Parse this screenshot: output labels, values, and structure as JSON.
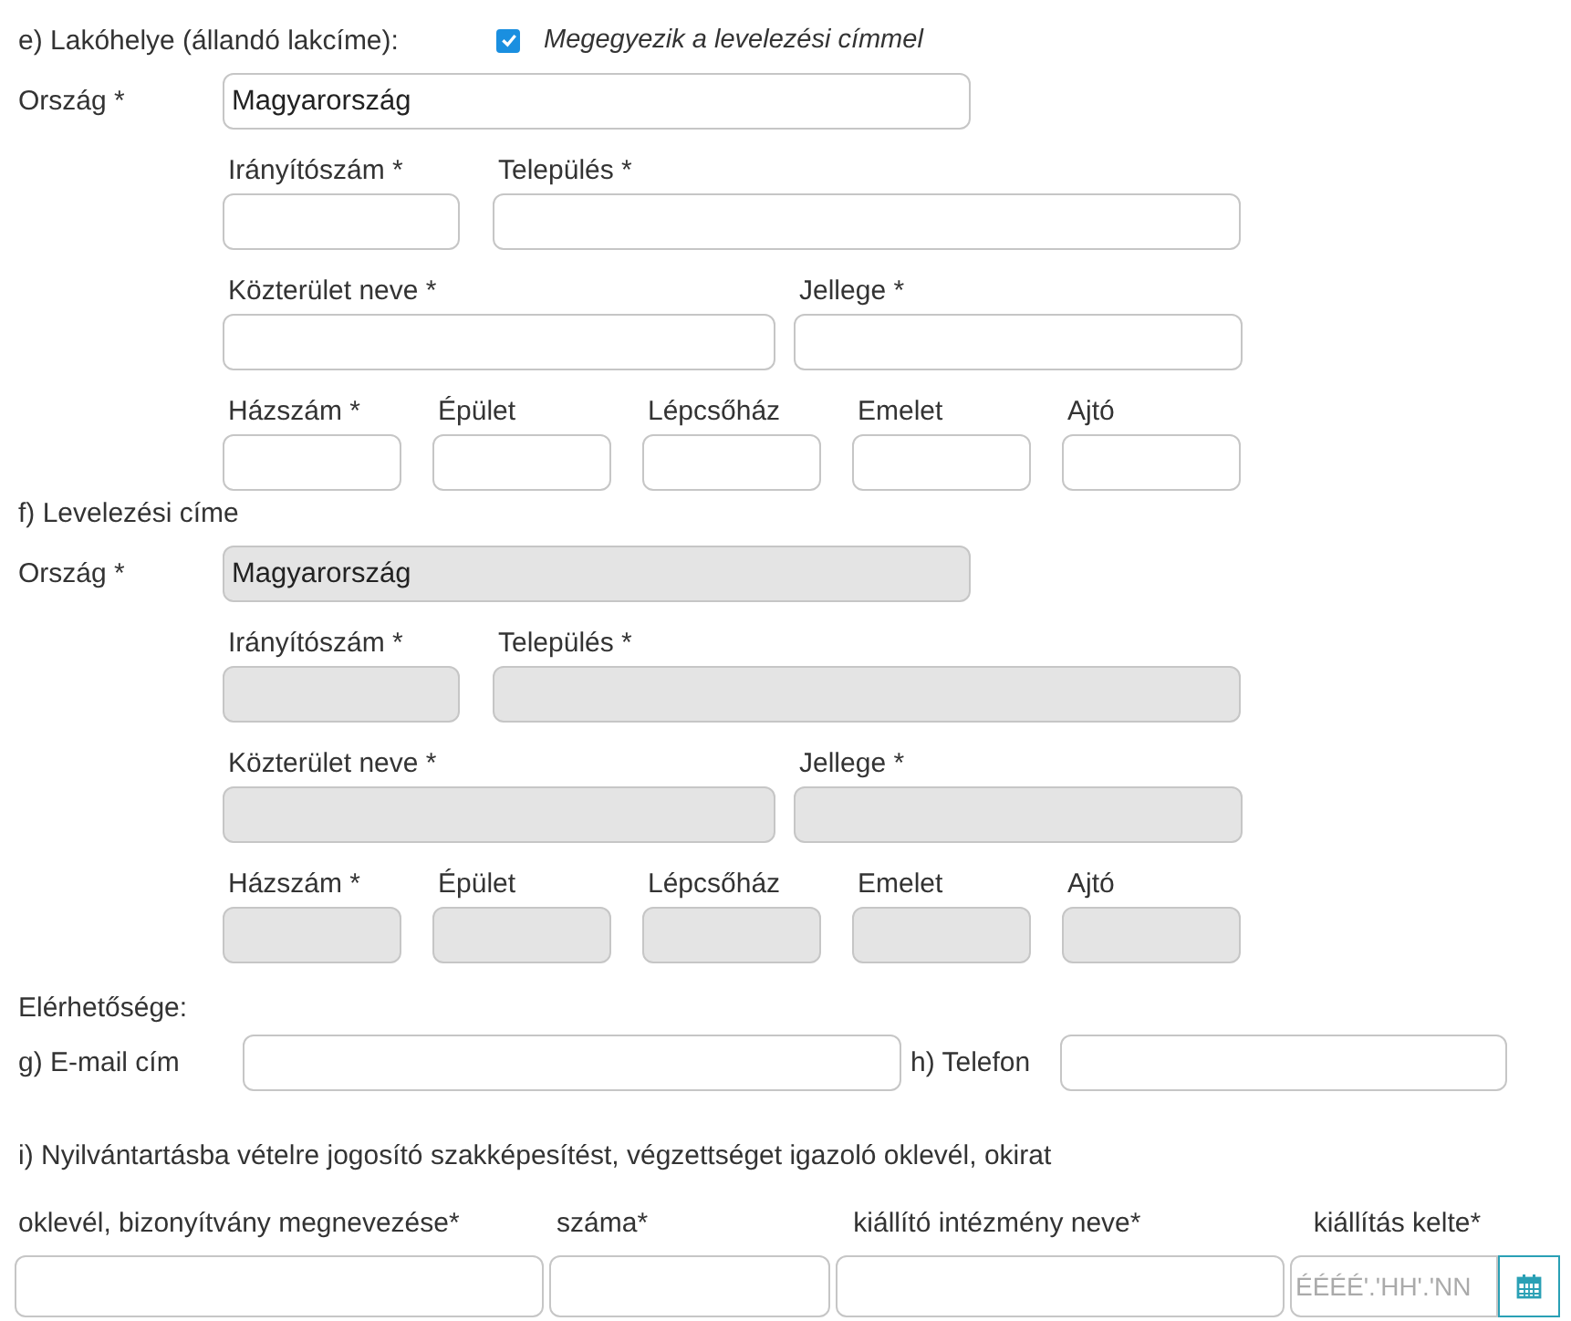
{
  "residence": {
    "heading": "e) Lakóhelye (állandó lakcíme):",
    "same_as_mailing": {
      "label": "Megegyezik a levelezési címmel",
      "checked": true
    },
    "country": {
      "label": "Ország *",
      "value": "Magyarország",
      "disabled": false
    },
    "rows": [
      [
        {
          "label": "Irányítószám *",
          "disabled": false
        },
        {
          "label": "Település *",
          "disabled": false
        }
      ],
      [
        {
          "label": "Közterület neve *",
          "disabled": false
        },
        {
          "label": "Jellege *",
          "disabled": false
        }
      ],
      [
        {
          "label": "Házszám *",
          "disabled": false
        },
        {
          "label": "Épület",
          "disabled": false
        },
        {
          "label": "Lépcsőház",
          "disabled": false
        },
        {
          "label": "Emelet",
          "disabled": false
        },
        {
          "label": "Ajtó",
          "disabled": false
        }
      ]
    ]
  },
  "mailing": {
    "heading": "f) Levelezési címe",
    "country": {
      "label": "Ország *",
      "value": "Magyarország",
      "disabled": true
    },
    "rows": [
      [
        {
          "label": "Irányítószám *",
          "disabled": true
        },
        {
          "label": "Település *",
          "disabled": true
        }
      ],
      [
        {
          "label": "Közterület neve *",
          "disabled": true
        },
        {
          "label": "Jellege *",
          "disabled": true
        }
      ],
      [
        {
          "label": "Házszám *",
          "disabled": true
        },
        {
          "label": "Épület",
          "disabled": true
        },
        {
          "label": "Lépcsőház",
          "disabled": true
        },
        {
          "label": "Emelet",
          "disabled": true
        },
        {
          "label": "Ajtó",
          "disabled": true
        }
      ]
    ]
  },
  "contact": {
    "heading": "Elérhetősége:",
    "email_label": "g) E-mail cím",
    "phone_label": "h) Telefon"
  },
  "qualification": {
    "heading": "i) Nyilvántartásba vételre jogosító szakképesítést, végzettséget igazoló oklevél, okirat",
    "columns": [
      "oklevél, bizonyítvány megnevezése*",
      "száma*",
      "kiállító intézmény neve*",
      "kiállítás kelte*"
    ],
    "date_placeholder": "ÉÉÉÉ'.'HH'.'NN"
  }
}
